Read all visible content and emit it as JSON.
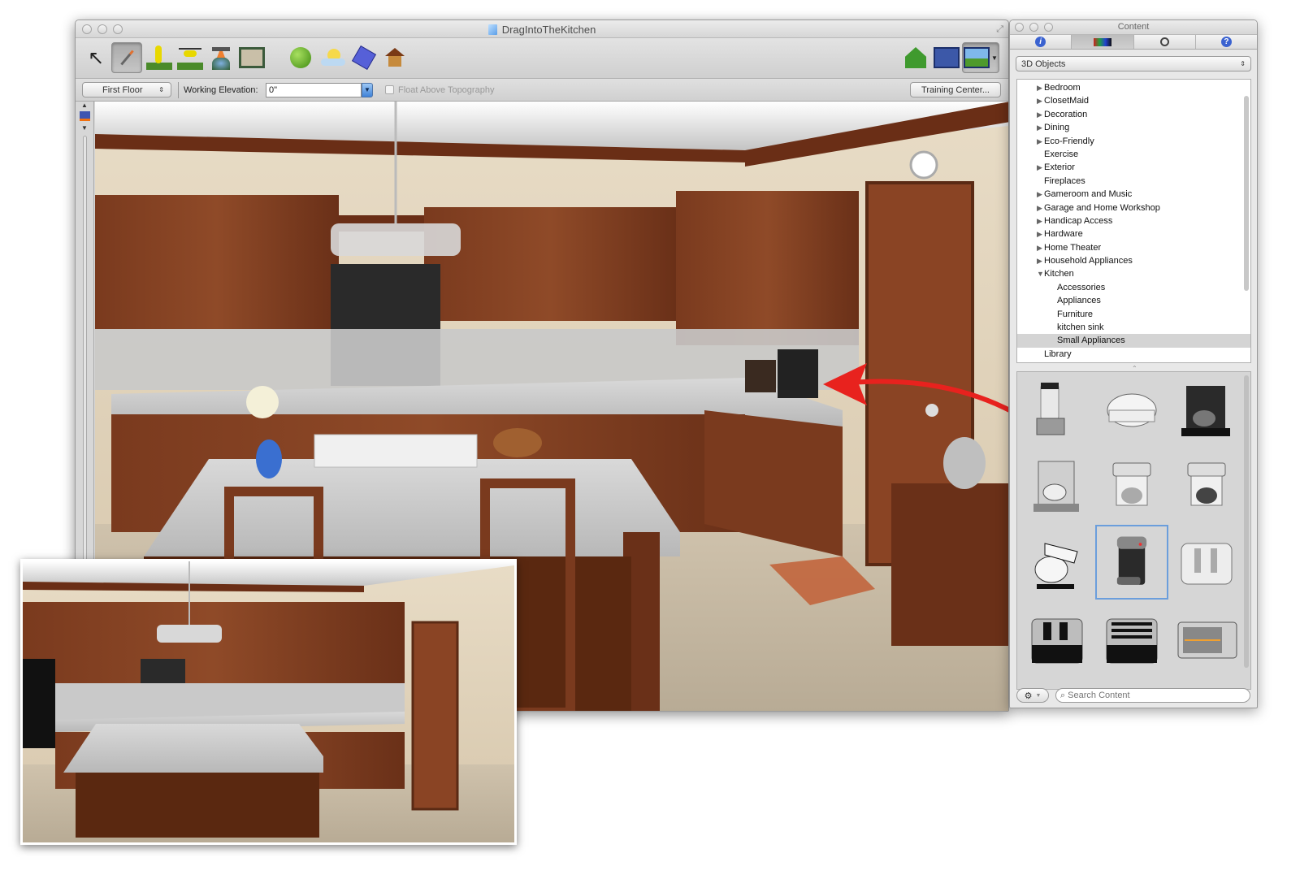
{
  "main_window": {
    "title": "DragIntoTheKitchen",
    "toolbar_left": [
      {
        "name": "select-tool",
        "icon": "arrow-cursor-icon",
        "glyph": "↖",
        "active": false
      },
      {
        "name": "wand-tool",
        "icon": "magic-wand-icon",
        "glyph": "/",
        "active": true
      },
      {
        "name": "walkthrough-tool",
        "icon": "walking-person-icon",
        "glyph": "🚶",
        "active": false
      },
      {
        "name": "fly-tool",
        "icon": "helicopter-icon",
        "glyph": "🚁",
        "active": false
      },
      {
        "name": "satellite-tool",
        "icon": "satellite-icon",
        "glyph": "🛰",
        "active": false
      },
      {
        "name": "floorplan-tool",
        "icon": "floor-plan-icon",
        "glyph": "▦",
        "active": false
      },
      {
        "name": "terrain-tool",
        "icon": "green-globe-icon",
        "glyph": "●",
        "active": false
      },
      {
        "name": "sun-tool",
        "icon": "sun-clouds-icon",
        "glyph": "☀",
        "active": false
      },
      {
        "name": "blueprint-tool",
        "icon": "blueprint-hammer-icon",
        "glyph": "◆",
        "active": false
      },
      {
        "name": "house-tool",
        "icon": "house-pencil-icon",
        "glyph": "⌂",
        "active": false
      }
    ],
    "toolbar_right": [
      {
        "name": "eco-house-button",
        "icon": "green-house-leaf-icon"
      },
      {
        "name": "plan-view-button",
        "icon": "blueprint-view-icon"
      },
      {
        "name": "3d-view-button",
        "icon": "landscape-view-icon"
      }
    ],
    "floor_select": "First Floor",
    "working_elevation_label": "Working Elevation:",
    "working_elevation_value": "0\"",
    "float_above_topography_label": "Float Above Topography",
    "float_above_topography_checked": false,
    "training_center_label": "Training Center..."
  },
  "content_window": {
    "title": "Content",
    "tabs": [
      {
        "name": "info",
        "icon": "info-icon",
        "glyph": "i"
      },
      {
        "name": "3d-objects",
        "icon": "color-swatches-icon",
        "glyph": "◆",
        "selected": true
      },
      {
        "name": "timer",
        "icon": "stopwatch-icon",
        "glyph": "⏱"
      },
      {
        "name": "help",
        "icon": "help-icon",
        "glyph": "?"
      }
    ],
    "category_select": "3D Objects",
    "tree": [
      {
        "label": "Bedroom",
        "level": 0,
        "expandable": true,
        "expanded": false
      },
      {
        "label": "ClosetMaid",
        "level": 0,
        "expandable": true,
        "expanded": false
      },
      {
        "label": "Decoration",
        "level": 0,
        "expandable": true,
        "expanded": false
      },
      {
        "label": "Dining",
        "level": 0,
        "expandable": true,
        "expanded": false
      },
      {
        "label": "Eco-Friendly",
        "level": 0,
        "expandable": true,
        "expanded": false
      },
      {
        "label": "Exercise",
        "level": 0,
        "expandable": false
      },
      {
        "label": "Exterior",
        "level": 0,
        "expandable": true,
        "expanded": false
      },
      {
        "label": "Fireplaces",
        "level": 0,
        "expandable": false
      },
      {
        "label": "Gameroom and Music",
        "level": 0,
        "expandable": true,
        "expanded": false
      },
      {
        "label": "Garage and Home Workshop",
        "level": 0,
        "expandable": true,
        "expanded": false
      },
      {
        "label": "Handicap Access",
        "level": 0,
        "expandable": true,
        "expanded": false
      },
      {
        "label": "Hardware",
        "level": 0,
        "expandable": true,
        "expanded": false
      },
      {
        "label": "Home Theater",
        "level": 0,
        "expandable": true,
        "expanded": false
      },
      {
        "label": "Household Appliances",
        "level": 0,
        "expandable": true,
        "expanded": false
      },
      {
        "label": "Kitchen",
        "level": 0,
        "expandable": true,
        "expanded": true
      },
      {
        "label": "Accessories",
        "level": 1,
        "expandable": false
      },
      {
        "label": "Appliances",
        "level": 1,
        "expandable": false
      },
      {
        "label": "Furniture",
        "level": 1,
        "expandable": false
      },
      {
        "label": "kitchen sink",
        "level": 1,
        "expandable": false
      },
      {
        "label": "Small Appliances",
        "level": 1,
        "expandable": false,
        "selected": true
      },
      {
        "label": "Library",
        "level": 0,
        "expandable": false
      }
    ],
    "objects": [
      {
        "name": "blender"
      },
      {
        "name": "roaster-pan"
      },
      {
        "name": "black-coffee-maker"
      },
      {
        "name": "drip-coffee-maker"
      },
      {
        "name": "coffee-maker-carafe"
      },
      {
        "name": "coffee-maker-white"
      },
      {
        "name": "stand-mixer"
      },
      {
        "name": "single-cup-brewer",
        "selected": true
      },
      {
        "name": "two-slice-toaster-white"
      },
      {
        "name": "two-slice-toaster-steel"
      },
      {
        "name": "four-slice-toaster"
      },
      {
        "name": "toaster-oven"
      }
    ],
    "search_placeholder": "Search Content",
    "action_menu_icon": "gear-icon"
  },
  "annotation": {
    "arrow_color": "#e8221e",
    "description": "drag arrow from selected single-cup brewer to kitchen counter"
  },
  "inset": {
    "description": "before view: empty kitchen"
  }
}
